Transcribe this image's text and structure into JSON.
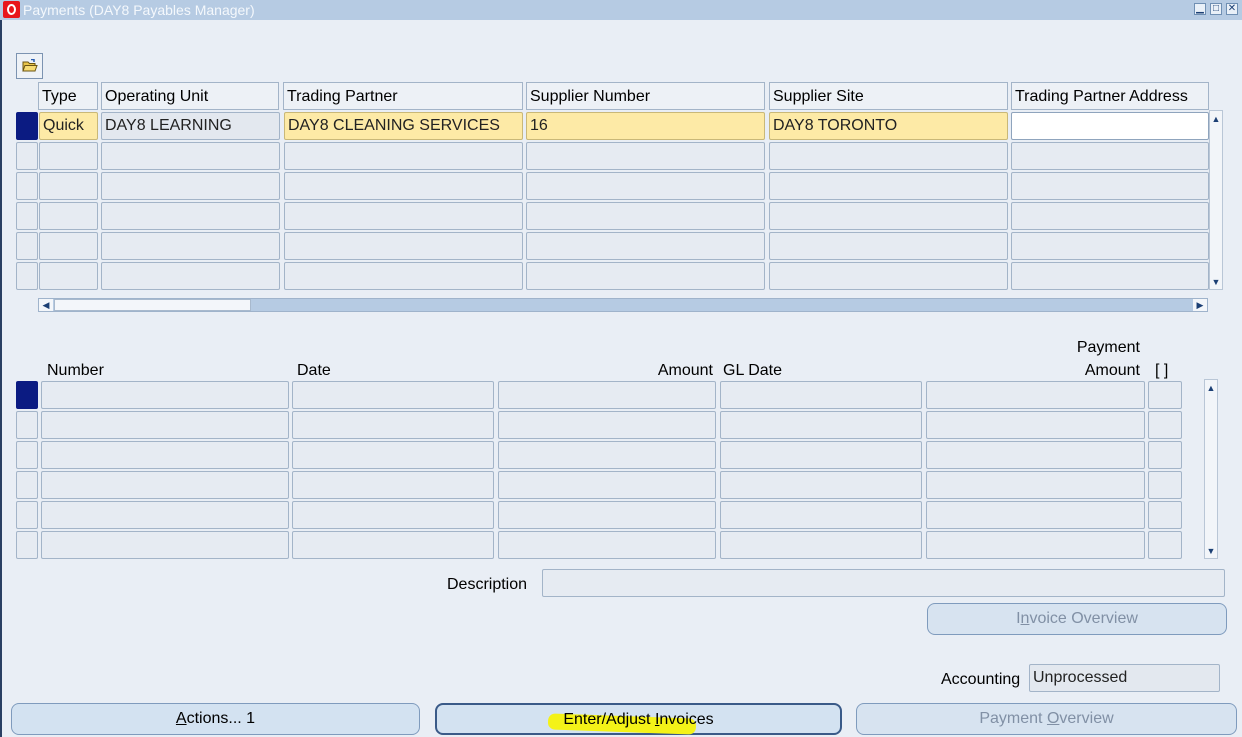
{
  "window": {
    "title": "Payments (DAY8 Payables Manager)",
    "controls": [
      "minimize",
      "maximize",
      "close"
    ]
  },
  "toolbar": {
    "folder_icon": "folder-open-icon"
  },
  "master": {
    "columns": [
      "Type",
      "Operating Unit",
      "Trading Partner",
      "Supplier Number",
      "Supplier Site",
      "Trading Partner Address"
    ],
    "row1": {
      "type": "Quick",
      "operating_unit": "DAY8 LEARNING",
      "trading_partner": "DAY8 CLEANING SERVICES",
      "supplier_number": "16",
      "supplier_site": "DAY8 TORONTO",
      "trading_partner_address": ""
    }
  },
  "detail": {
    "col_number": "Number",
    "col_date": "Date",
    "col_amount": "Amount",
    "col_gl_date": "GL Date",
    "col_payment_amount_line1": "Payment",
    "col_payment_amount_line2": "Amount",
    "col_flag": "[ ]"
  },
  "description": {
    "label": "Description",
    "value": ""
  },
  "accounting": {
    "label": "Accounting",
    "value": "Unprocessed"
  },
  "buttons": {
    "invoice_overview": {
      "label_pre": "I",
      "label_mnemonic": "n",
      "label_post": "voice Overview"
    },
    "actions": {
      "label_mnemonic": "A",
      "label_post": "ctions... 1"
    },
    "enter_adjust": {
      "label_pre": "Enter/Adjust ",
      "label_mnemonic": "I",
      "label_post": "nvoices"
    },
    "payment_overview": {
      "label_pre": "Payment ",
      "label_mnemonic": "O",
      "label_post": "verview"
    }
  },
  "colors": {
    "title_bar": "#b6cbe3",
    "required_field": "#fdeaa6",
    "selected_row": "#0b1b82",
    "highlighter": "#f4f218"
  }
}
